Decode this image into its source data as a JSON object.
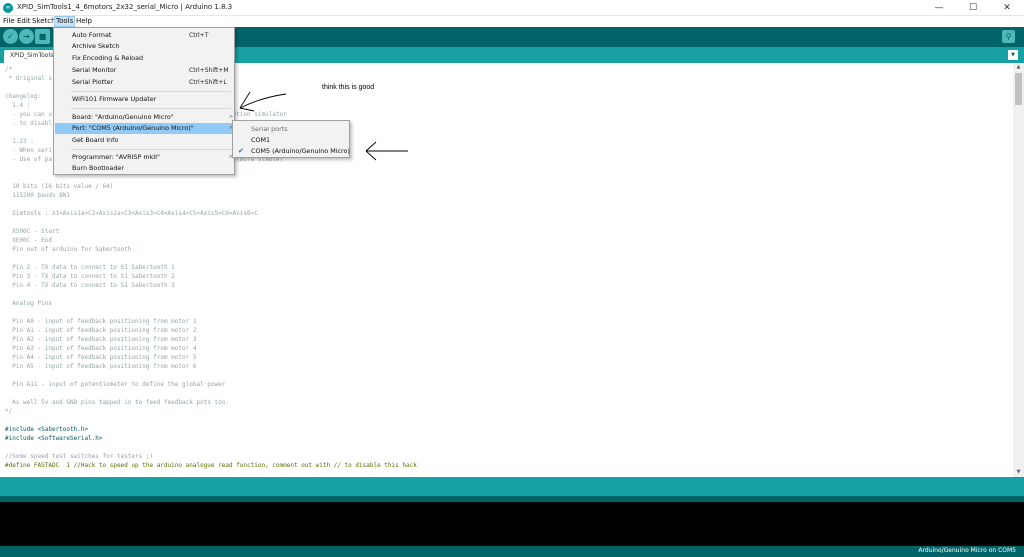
{
  "window": {
    "title": "XPID_SimTools1_4_6motors_2x32_serial_Micro | Arduino 1.8.3",
    "minimize": "—",
    "maximize": "☐",
    "close": "✕"
  },
  "menubar": {
    "items": [
      "File",
      "Edit",
      "Sketch",
      "Tools",
      "Help"
    ],
    "active": "Tools"
  },
  "toolbar": {
    "verify": "✓",
    "upload": "→",
    "new": "■",
    "serial_monitor": "⚲"
  },
  "tab": {
    "label": "XPID_SimTools1",
    "menu": "▼"
  },
  "tools_menu": {
    "items": [
      {
        "label": "Auto Format",
        "shortcut": "Ctrl+T"
      },
      {
        "label": "Archive Sketch",
        "shortcut": ""
      },
      {
        "label": "Fix Encoding & Reload",
        "shortcut": ""
      },
      {
        "label": "Serial Monitor",
        "shortcut": "Ctrl+Shift+M"
      },
      {
        "label": "Serial Plotter",
        "shortcut": "Ctrl+Shift+L"
      },
      {
        "label": "WiFi101 Firmware Updater",
        "shortcut": ""
      },
      {
        "label": "Board: \"Arduino/Genuino Micro\"",
        "shortcut": ""
      },
      {
        "label": "Port: \"COM5 (Arduino/Genuino Micro)\"",
        "shortcut": ""
      },
      {
        "label": "Get Board Info",
        "shortcut": ""
      },
      {
        "label": "Programmer: \"AVRISP mkII\"",
        "shortcut": ""
      },
      {
        "label": "Burn Bootloader",
        "shortcut": ""
      }
    ],
    "submenu_arrow": ">"
  },
  "port_menu": {
    "header": "Serial ports",
    "items": [
      "COM1",
      "COM5 (Arduino/Genuino Micro)"
    ],
    "selected": "COM5 (Arduino/Genuino Micro)",
    "check": "✔"
  },
  "annotation": {
    "note": "think this is good"
  },
  "code": {
    "lines": [
      {
        "text": "/*",
        "style": "comment"
      },
      {
        "text": " * Original s",
        "style": "comment"
      },
      {
        "text": "",
        "style": "comment"
      },
      {
        "text": "changelog:",
        "style": "comment"
      },
      {
        "text": "  1.4 :",
        "style": "comment"
      },
      {
        "text": "  - you can u                                             the motion simulator",
        "style": "comment"
      },
      {
        "text": "  - to disabl",
        "style": "comment"
      },
      {
        "text": "",
        "style": "comment"
      },
      {
        "text": "  1.23 :",
        "style": "comment"
      },
      {
        "text": "  - When seri",
        "style": "comment"
      },
      {
        "text": "  - Use of pa                                             erial (more stable)",
        "style": "comment"
      },
      {
        "text": "",
        "style": "comment"
      },
      {
        "text": "",
        "style": "comment"
      },
      {
        "text": "  10 bits (16 bits value / 64)",
        "style": "comment"
      },
      {
        "text": "  115200 bauds 8N1",
        "style": "comment"
      },
      {
        "text": "",
        "style": "comment"
      },
      {
        "text": "  Simtools : X1<Axis1a>C2<Axis2a>C3<Axis3>C4<Axis4>C5<Axis5>C6<Axis6>C",
        "style": "comment"
      },
      {
        "text": "",
        "style": "comment"
      },
      {
        "text": "  X500C - Start",
        "style": "comment"
      },
      {
        "text": "  XE00C - End",
        "style": "comment"
      },
      {
        "text": "  Pin out of arduino for Sabertooth",
        "style": "comment"
      },
      {
        "text": "",
        "style": "comment"
      },
      {
        "text": "  Pin 2 - TX data to connect to S1 Sabertooth 1",
        "style": "comment"
      },
      {
        "text": "  Pin 3 - TX data to connect to S1 Sabertooth 2",
        "style": "comment"
      },
      {
        "text": "  Pin 4 - TX data to connect to S1 Sabertooth 3",
        "style": "comment"
      },
      {
        "text": "",
        "style": "comment"
      },
      {
        "text": "  Analog Pins",
        "style": "comment"
      },
      {
        "text": "",
        "style": "comment"
      },
      {
        "text": "  Pin A0 - input of feedback positioning from motor 1",
        "style": "comment"
      },
      {
        "text": "  Pin A1 - input of feedback positioning from motor 2",
        "style": "comment"
      },
      {
        "text": "  Pin A2 - input of feedback positioning from motor 3",
        "style": "comment"
      },
      {
        "text": "  Pin A3 - input of feedback positioning from motor 4",
        "style": "comment"
      },
      {
        "text": "  Pin A4 - input of feedback positioning from motor 5",
        "style": "comment"
      },
      {
        "text": "  Pin A5 - input of feedback positioning from motor 6",
        "style": "comment"
      },
      {
        "text": "",
        "style": "comment"
      },
      {
        "text": "  Pin A11 - input of potentiometer to define the global power",
        "style": "comment"
      },
      {
        "text": "",
        "style": "comment"
      },
      {
        "text": "  As well 5v and GND pins tapped in to feed feedback pots too.",
        "style": "comment"
      },
      {
        "text": "*/",
        "style": "comment"
      },
      {
        "text": "",
        "style": "comment"
      },
      {
        "text": "#include <Sabertooth.h>",
        "style": "include"
      },
      {
        "text": "#include <SoftwareSerial.h>",
        "style": "include"
      },
      {
        "text": "",
        "style": "comment"
      },
      {
        "text": "//Some speed test switches for testers ;)",
        "style": "comment"
      },
      {
        "text": "#define FASTADC  1 //Hack to speed up the arduino analogue read function, comment out with // to disable this hack",
        "style": "define"
      }
    ]
  },
  "status": {
    "board": "Arduino/Genuino Micro on COM5"
  },
  "colors": {
    "toolbar": "#006468",
    "tabstrip": "#17a1a5",
    "menu_bg": "#f2f2f2",
    "menu_highlight": "#91c9f7",
    "comment": "#95a5a6",
    "console": "#000000"
  }
}
